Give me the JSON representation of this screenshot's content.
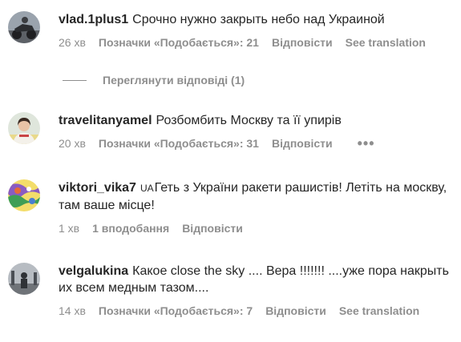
{
  "comments": [
    {
      "username": "vlad.1plus1",
      "text": "Срочно нужно закрыть небо над Украиной",
      "time": "26 хв",
      "likes_label": "Позначки «Подобається»: 21",
      "reply_label": "Відповісти",
      "translate_label": "See translation"
    },
    {
      "username": "travelitanyamel",
      "text": "Розбомбить Москву та її упирів",
      "time": "20 хв",
      "likes_label": "Позначки «Подобається»: 31",
      "reply_label": "Відповісти",
      "more_label": "•••"
    },
    {
      "username": "viktori_vika7",
      "flag": "UA",
      "text": "Геть з України ракети рашистів! Летіть на москву, там ваше місце!",
      "time": "1 хв",
      "likes_label": "1 вподобання",
      "reply_label": "Відповісти"
    },
    {
      "username": "velgalukina",
      "text": "Какое close the sky .... Вера !!!!!!! ....уже пора накрыть их всем медным тазом....",
      "time": "14 хв",
      "likes_label": "Позначки «Подобається»: 7",
      "reply_label": "Відповісти",
      "translate_label": "See translation"
    }
  ],
  "replies_toggle": {
    "label": "Переглянути відповіді (1)"
  },
  "colors": {
    "text": "#262626",
    "secondary": "#8e8e8e",
    "background": "#ffffff"
  }
}
